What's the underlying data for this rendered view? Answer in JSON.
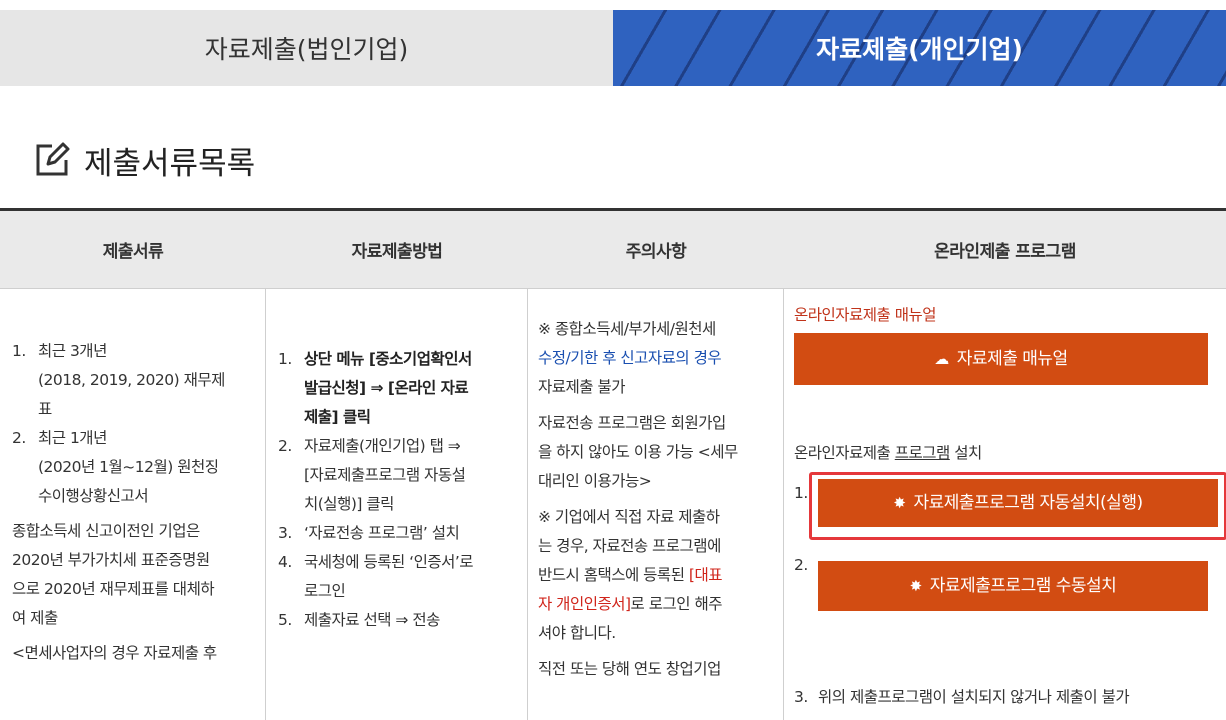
{
  "tabs": [
    {
      "label": "자료제출(법인기업)",
      "active": false
    },
    {
      "label": "자료제출(개인기업)",
      "active": true
    }
  ],
  "section": {
    "title": "제출서류목록",
    "icon": "edit-icon"
  },
  "table": {
    "headers": [
      "제출서류",
      "자료제출방법",
      "주의사항",
      "온라인제출 프로그램"
    ],
    "col1": {
      "item1_num": "1.",
      "item1_lines": [
        "최근 3개년",
        "(2018, 2019, 2020) 재무제",
        "표"
      ],
      "item2_num": "2.",
      "item2_lines": [
        "최근 1개년",
        "(2020년 1월~12월) 원천징",
        "수이행상황신고서"
      ],
      "para": [
        "종합소득세 신고이전인 기업은",
        "2020년 부가가치세 표준증명원",
        "으로 2020년 재무제표를 대체하",
        "여 제출"
      ],
      "note": "<면세사업자의 경우 자료제출 후"
    },
    "col2": {
      "item1_num": "1.",
      "item1_lines": [
        "상단 메뉴 [중소기업확인서",
        "발급신청] ⇒ [온라인 자료",
        "제출] 클릭"
      ],
      "item2_num": "2.",
      "item2_lines": [
        "자료제출(개인기업) 탭 ⇒",
        "[자료제출프로그램 자동설",
        "치(실행)] 클릭"
      ],
      "item3_num": "3.",
      "item3_text": "‘자료전송 프로그램’ 설치",
      "item4_num": "4.",
      "item4_lines": [
        "국세청에 등록된 ‘인증서’로",
        "로그인"
      ],
      "item5_num": "5.",
      "item5_text": "제출자료 선택 ⇒ 전송"
    },
    "col3": {
      "b1_l1": "※ 종합소득세/부가세/원천세",
      "b1_l2_blue": "수정/기한 후 신고자료의 경우",
      "b1_l3": "자료제출 불가",
      "b2_lines": [
        "자료전송 프로그램은 회원가입",
        "을 하지 않아도 이용 가능 <세무",
        "대리인 이용가능>"
      ],
      "b3_l1": "※ 기업에서 직접 자료 제출하",
      "b3_l2": "는 경우, 자료전송 프로그램에",
      "b3_l3a": "반드시 홈택스에 등록된 ",
      "b3_l3b_red": "[대표",
      "b3_l4a_red": "자 개인인증서]",
      "b3_l4b": "로 로그인 해주",
      "b3_l5": "셔야 합니다.",
      "b4": "직전 또는 당해 연도 창업기업"
    },
    "col4": {
      "manual_label": "온라인자료제출 매뉴얼",
      "manual_button": "자료제출 매뉴얼",
      "install_prefix": "온라인자료제출 ",
      "install_underlined": "프로그램",
      "install_suffix": " 설치",
      "n1": "1.",
      "auto_button": "자료제출프로그램 자동설치(실행)",
      "n2": "2.",
      "manual_install_button": "자료제출프로그램 수동설치",
      "n3": "3.",
      "n3_text": "위의 제출프로그램이 설치되지 않거나 제출이 불가"
    }
  },
  "colors": {
    "accent_blue": "#2f62bf",
    "button_orange": "#d24c12",
    "highlight_red": "#e5383b"
  }
}
